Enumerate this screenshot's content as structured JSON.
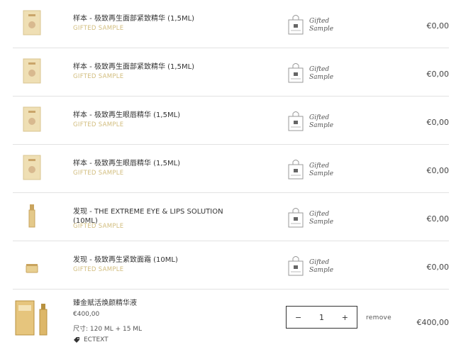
{
  "items": [
    {
      "title": "样本 - 极致再生面部紧致精华 (1,5ML)",
      "sub": "GIFTED SAMPLE",
      "gift": [
        "Gifted",
        "Sample"
      ],
      "price": "€0,00"
    },
    {
      "title": "样本 - 极致再生面部紧致精华 (1,5ML)",
      "sub": "GIFTED SAMPLE",
      "gift": [
        "Gifted",
        "Sample"
      ],
      "price": "€0,00"
    },
    {
      "title": "样本 - 极致再生眼唇精华 (1,5ML)",
      "sub": "GIFTED SAMPLE",
      "gift": [
        "Gifted",
        "Sample"
      ],
      "price": "€0,00"
    },
    {
      "title": "样本 - 极致再生眼唇精华 (1,5ML)",
      "sub": "GIFTED SAMPLE",
      "gift": [
        "Gifted",
        "Sample"
      ],
      "price": "€0,00"
    },
    {
      "title": "发现 - THE EXTREME EYE & LIPS SOLUTION\n(10ML)",
      "sub": "GIFTED SAMPLE",
      "gift": [
        "Gifted",
        "Sample"
      ],
      "price": "€0,00"
    },
    {
      "title": "发现 - 极致再生紧致面霜 (10ML)",
      "sub": "GIFTED SAMPLE",
      "gift": [
        "Gifted",
        "Sample"
      ],
      "price": "€0,00"
    }
  ],
  "product": {
    "title": "臻金赋活焕颜精华液",
    "unit_price": "€400,00",
    "size": "尺寸: 120 ML + 15 ML",
    "tag": "ECTEXT",
    "qty_minus": "−",
    "qty_value": "1",
    "qty_plus": "+",
    "remove": "remove",
    "total": "€400,00"
  },
  "colors": {
    "gold": "#d2bd7e",
    "border": "#e2e2e2"
  }
}
